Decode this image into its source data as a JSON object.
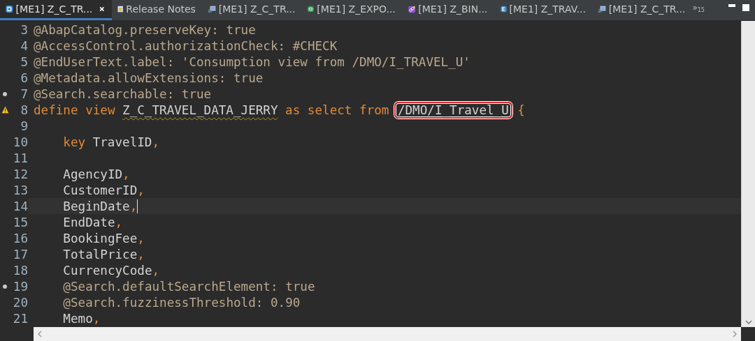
{
  "tabs": [
    {
      "label": "[ME1] Z_C_TR...",
      "kind": "ddl",
      "selected": true,
      "closable": true
    },
    {
      "label": "Release Notes",
      "kind": "notes",
      "selected": false
    },
    {
      "label": "[ME1] Z_C_TR...",
      "kind": "table",
      "selected": false
    },
    {
      "label": "[ME1] Z_EXPO...",
      "kind": "service",
      "selected": false
    },
    {
      "label": "[ME1] Z_BIN...",
      "kind": "binding",
      "selected": false
    },
    {
      "label": "[ME1] Z_TRAV...",
      "kind": "entity",
      "selected": false
    },
    {
      "label": "[ME1] Z_C_TR...",
      "kind": "table",
      "selected": false
    }
  ],
  "overflow": {
    "symbol": "»",
    "count": "15"
  },
  "lines": [
    {
      "number": "3",
      "tokens": [
        {
          "kind": "annotation",
          "text": "@AbapCatalog.preserveKey: true"
        }
      ]
    },
    {
      "number": "4",
      "tokens": [
        {
          "kind": "annotation",
          "text": "@AccessControl.authorizationCheck: #CHECK"
        }
      ]
    },
    {
      "number": "5",
      "tokens": [
        {
          "kind": "annotation",
          "text": "@EndUserText.label: 'Consumption view from /DMO/I_TRAVEL_U'"
        }
      ]
    },
    {
      "number": "6",
      "tokens": [
        {
          "kind": "annotation",
          "text": "@Metadata.allowExtensions: true"
        }
      ]
    },
    {
      "number": "7",
      "kind": "marked",
      "tokens": [
        {
          "kind": "annotation",
          "text": "@Search.searchable: true"
        }
      ]
    },
    {
      "number": "8",
      "kind": "warning",
      "tokens": [
        {
          "kind": "keyword",
          "text": "define view"
        },
        {
          "kind": "name",
          "text": "Z_C_TRAVEL_DATA_JERRY",
          "flagged": true
        },
        {
          "kind": "keyword",
          "text": "as select from"
        },
        {
          "kind": "name",
          "text": "/DMO/I_Travel_U",
          "highlighted": true
        },
        {
          "kind": "punct",
          "text": "{"
        }
      ]
    },
    {
      "number": "9"
    },
    {
      "number": "10",
      "indented": true,
      "tokens": [
        {
          "kind": "keyword",
          "text": "key"
        },
        {
          "kind": "name",
          "text": "TravelID"
        },
        {
          "kind": "punct",
          "text": ","
        }
      ]
    },
    {
      "number": "11"
    },
    {
      "number": "12",
      "indented": true,
      "tokens": [
        {
          "kind": "name",
          "text": "AgencyID"
        },
        {
          "kind": "punct",
          "text": ","
        }
      ]
    },
    {
      "number": "13",
      "indented": true,
      "tokens": [
        {
          "kind": "name",
          "text": "CustomerID"
        },
        {
          "kind": "punct",
          "text": ","
        }
      ]
    },
    {
      "number": "14",
      "indented": true,
      "current": true,
      "tokens": [
        {
          "kind": "name",
          "text": "BeginDate"
        },
        {
          "kind": "punct",
          "text": ","
        }
      ]
    },
    {
      "number": "15",
      "indented": true,
      "tokens": [
        {
          "kind": "name",
          "text": "EndDate"
        },
        {
          "kind": "punct",
          "text": ","
        }
      ]
    },
    {
      "number": "16",
      "indented": true,
      "tokens": [
        {
          "kind": "name",
          "text": "BookingFee"
        },
        {
          "kind": "punct",
          "text": ","
        }
      ]
    },
    {
      "number": "17",
      "indented": true,
      "tokens": [
        {
          "kind": "name",
          "text": "TotalPrice"
        },
        {
          "kind": "punct",
          "text": ","
        }
      ]
    },
    {
      "number": "18",
      "indented": true,
      "tokens": [
        {
          "kind": "name",
          "text": "CurrencyCode"
        },
        {
          "kind": "punct",
          "text": ","
        }
      ]
    },
    {
      "number": "19",
      "kind": "marked",
      "indented": true,
      "tokens": [
        {
          "kind": "annotation",
          "text": "@Search.defaultSearchElement: true"
        }
      ]
    },
    {
      "number": "20",
      "indented": true,
      "tokens": [
        {
          "kind": "annotation",
          "text": "@Search.fuzzinessThreshold: 0.90"
        }
      ]
    },
    {
      "number": "21",
      "indented": true,
      "tokens": [
        {
          "kind": "name",
          "text": "Memo"
        },
        {
          "kind": "punct",
          "text": ","
        }
      ]
    }
  ]
}
